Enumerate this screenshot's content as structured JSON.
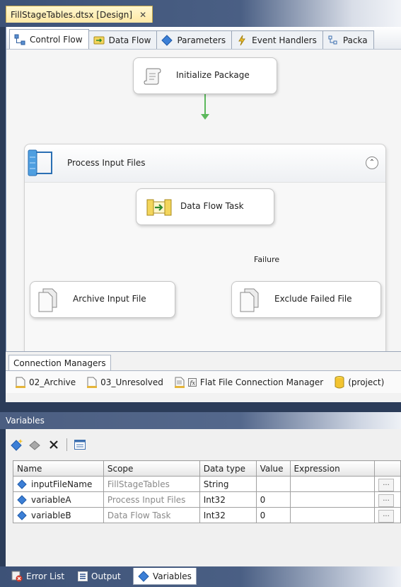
{
  "document_tab": {
    "title": "FillStageTables.dtsx [Design]",
    "close": "✕"
  },
  "designer_tabs": [
    {
      "label": "Control Flow",
      "icon": "control-flow-icon"
    },
    {
      "label": "Data Flow",
      "icon": "data-flow-icon"
    },
    {
      "label": "Parameters",
      "icon": "parameters-icon"
    },
    {
      "label": "Event Handlers",
      "icon": "event-handlers-icon"
    },
    {
      "label": "Packa",
      "icon": "package-explorer-icon"
    }
  ],
  "control_flow": {
    "initialize_task": "Initialize Package",
    "container": {
      "title": "Process Input Files",
      "collapse": "⌃"
    },
    "data_flow_task": "Data Flow Task",
    "archive_task": "Archive Input File",
    "exclude_task": "Exclude Failed File",
    "failure_label": "Failure",
    "colors": {
      "success": "#5cb85c",
      "failure": "#c0451a"
    }
  },
  "connection_managers": {
    "tab_label": "Connection Managers",
    "items": [
      {
        "label": "02_Archive",
        "icon": "file-connection-icon"
      },
      {
        "label": "03_Unresolved",
        "icon": "file-connection-icon"
      },
      {
        "label": "Flat File Connection Manager",
        "icon": "flat-file-connection-icon"
      },
      {
        "label": "(project)",
        "icon": "project-connection-icon"
      }
    ]
  },
  "variables": {
    "title": "Variables",
    "columns": [
      "Name",
      "Scope",
      "Data type",
      "Value",
      "Expression",
      ""
    ],
    "rows": [
      {
        "name": "inputFileName",
        "scope": "FillStageTables",
        "data_type": "String",
        "value": "",
        "expression": "",
        "button": "..."
      },
      {
        "name": "variableA",
        "scope": "Process Input Files",
        "data_type": "Int32",
        "value": "0",
        "expression": "",
        "button": "..."
      },
      {
        "name": "variableB",
        "scope": "Data Flow Task",
        "data_type": "Int32",
        "value": "0",
        "expression": "",
        "button": "..."
      }
    ]
  },
  "bottom_tabs": [
    {
      "label": "Error List",
      "icon": "error-list-icon"
    },
    {
      "label": "Output",
      "icon": "output-icon"
    },
    {
      "label": "Variables",
      "icon": "variables-icon"
    }
  ]
}
